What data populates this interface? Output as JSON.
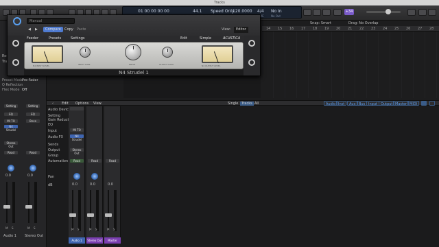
{
  "window": {
    "title": "Tracks"
  },
  "lcd": {
    "position": "01 00 00 00 00",
    "tempo_value": "44.1",
    "mode": "Speed Only",
    "bpm": "120.0000",
    "signature": "4/4",
    "input": "No In",
    "position_sub": "BAR  BEAT  DIV  TICK",
    "tempo_sub": "KHZ",
    "bpm_sub": "TEMPO",
    "sig_sub": "TIME",
    "input_sub": "No Out"
  },
  "toolbar": {
    "badge": "+34"
  },
  "inspector": {
    "region_label": "Reg",
    "track_label": "Tra",
    "preset_mode_label": "Preset Mode",
    "preset_mode_value": "Pre-Fader",
    "bypass_label": "Q Reflection",
    "flex_mode_label": "Flex Mode",
    "flex_mode_value": "Off",
    "ch1": {
      "setting": "Setting",
      "eq": "EQ",
      "input": "MI TO",
      "output": "N4 Strudel",
      "stereo_out": "Stereo Out",
      "read": "Read",
      "volume": "0.0",
      "name": "Audio 1"
    },
    "ch2": {
      "setting": "Setting",
      "eq": "EQ",
      "input": "Bnce",
      "output": "",
      "read": "Read",
      "volume": "0.0",
      "name": "Stereo Out"
    }
  },
  "tracks": {
    "header_left": "Snap: Smart",
    "header_right": "Drag: No Overlap",
    "ruler": [
      "14",
      "15",
      "16",
      "17",
      "18",
      "19",
      "20",
      "21",
      "22",
      "23",
      "24",
      "25",
      "26",
      "27",
      "28"
    ]
  },
  "plugin": {
    "preset": "Manual",
    "tabs": [
      "Compare",
      "Copy",
      "Paste"
    ],
    "view_label": "View:",
    "view_value": "Editor",
    "bottom_tabs": [
      "Feeder",
      "Presets",
      "Settings"
    ],
    "right_tabs": [
      "Edit",
      "Simple"
    ],
    "brand": "ACUSTICA",
    "knob_labels": [
      "INPUT GAIN",
      "DRIVE",
      "OUTPUT GAIN",
      "BYPASS"
    ],
    "meter_labels": [
      "N4 INPUT LEVEL",
      "N4 OUTPUT LEVEL"
    ],
    "name": "N4 Strudel 1"
  },
  "mixer": {
    "buttons": [
      "Edit",
      "Options",
      "View"
    ],
    "view_tabs": [
      "Single",
      "Tracks",
      "All"
    ],
    "filters": [
      "Audio",
      "Inst",
      "Aux",
      "Bus",
      "Input",
      "Output",
      "Master",
      "MIDI"
    ],
    "row_labels": [
      "Audio Device",
      "Setting",
      "Gain Reduction",
      "EQ",
      "Input",
      "Audio FX",
      "Sends",
      "Output",
      "Group",
      "Automation",
      "Pan",
      "dB"
    ],
    "channels": [
      {
        "name": "Audio 1",
        "input": "MI TO",
        "output": "Stereo Out",
        "fx": "N4 Strudel",
        "read": "Read",
        "db": "0.0",
        "color": "#3f65b0"
      },
      {
        "name": "Stereo Out",
        "input": "",
        "output": "",
        "fx": "",
        "read": "Read",
        "db": "0.0",
        "color": "#7a3fb0"
      },
      {
        "name": "Master",
        "input": "",
        "output": "",
        "fx": "",
        "read": "Read",
        "db": "0.0",
        "color": "#7a3fb0"
      }
    ],
    "ms": [
      "M",
      "S"
    ]
  }
}
